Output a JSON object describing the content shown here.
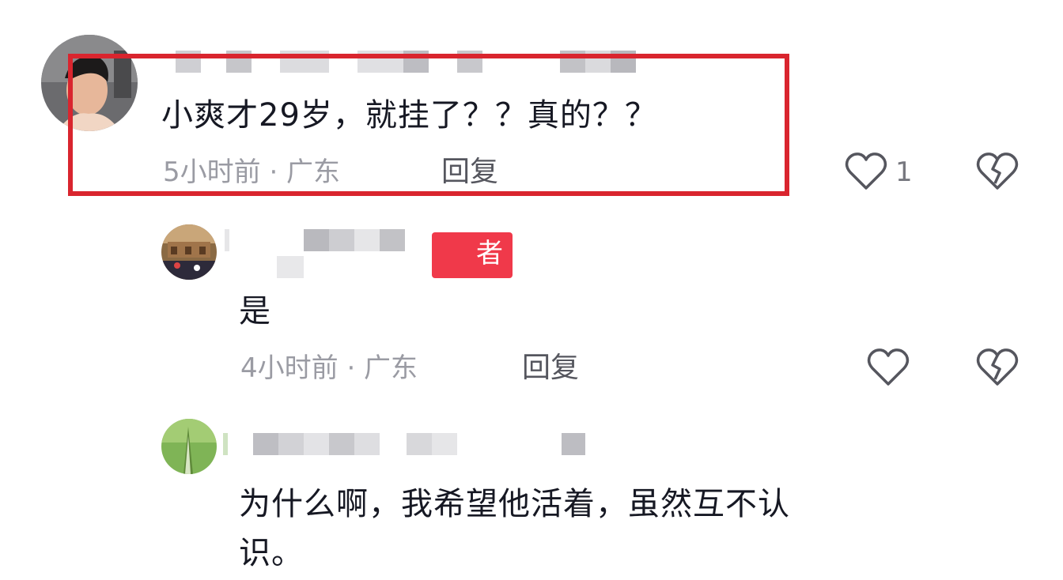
{
  "comments": [
    {
      "text": "小爽才29岁，就挂了？？真的？？",
      "meta": "5小时前 · 广东",
      "reply_label": "回复",
      "like_count": "1",
      "like_icon": "heart-outline-icon",
      "dislike_icon": "broken-heart-icon"
    },
    {
      "badge_text": "者",
      "text": "是",
      "meta": "4小时前 · 广东",
      "reply_label": "回复",
      "like_icon": "heart-outline-icon",
      "dislike_icon": "broken-heart-icon"
    },
    {
      "text_line1": "为什么啊，我希望他活着，虽然互不认",
      "text_line2": "识。"
    }
  ],
  "colors": {
    "highlight": "#d9252e",
    "badge": "#f0394a",
    "meta_text": "#9a9ba3",
    "main_text": "#161823"
  }
}
